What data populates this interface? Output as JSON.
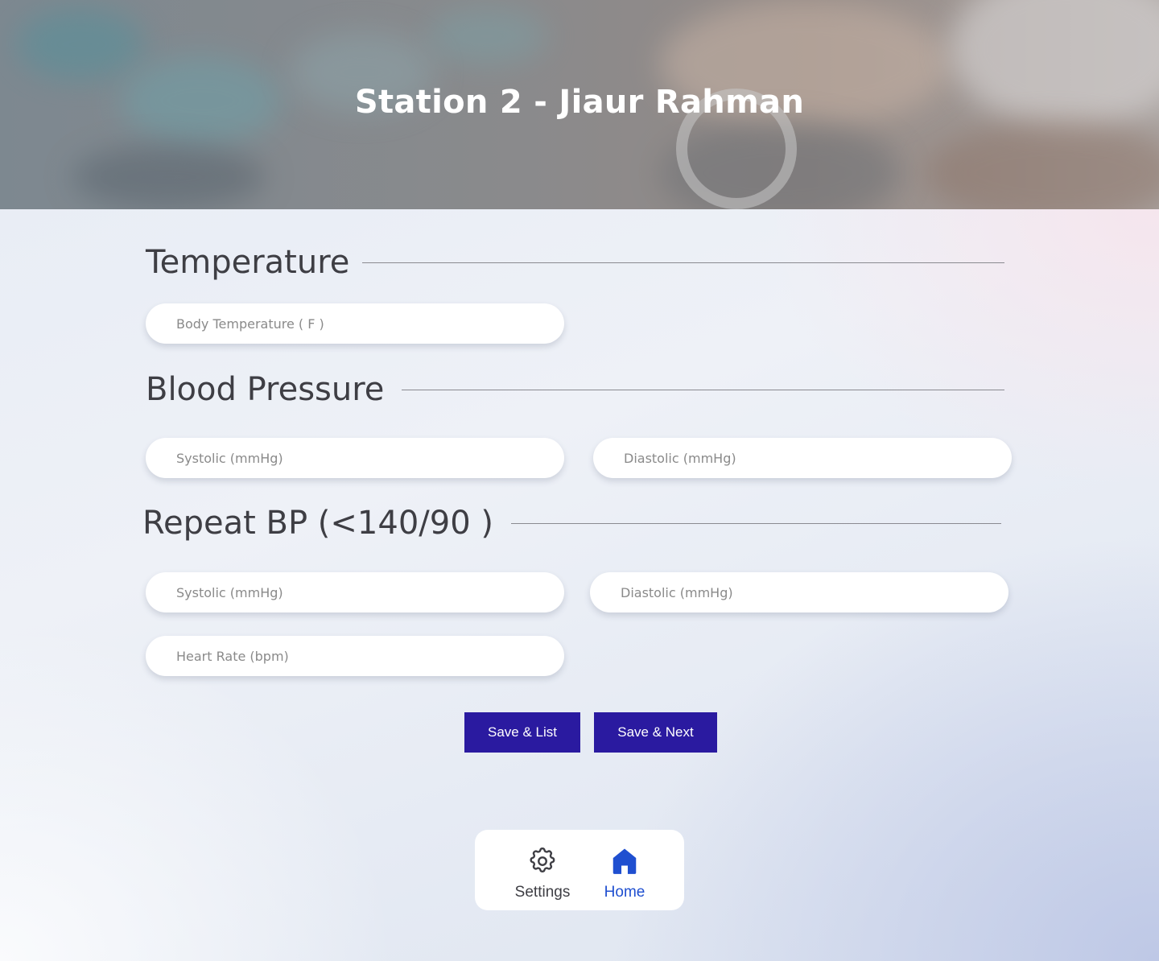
{
  "header": {
    "title": "Station 2 - Jiaur Rahman"
  },
  "sections": {
    "temperature": {
      "title": "Temperature",
      "body_temp_placeholder": "Body Temperature ( F )"
    },
    "blood_pressure": {
      "title": "Blood Pressure",
      "systolic_placeholder": "Systolic (mmHg)",
      "diastolic_placeholder": "Diastolic (mmHg)"
    },
    "repeat_bp": {
      "title": "Repeat BP (<140/90 )",
      "systolic_placeholder": "Systolic (mmHg)",
      "diastolic_placeholder": "Diastolic (mmHg)",
      "heart_rate_placeholder": "Heart Rate (bpm)"
    }
  },
  "actions": {
    "save_list_label": "Save & List",
    "save_next_label": "Save & Next"
  },
  "bottom_nav": {
    "items": [
      {
        "label": "Settings",
        "icon": "gear-icon",
        "active": false
      },
      {
        "label": "Home",
        "icon": "home-icon",
        "active": true
      }
    ]
  },
  "colors": {
    "primary_button": "#2a1aa0",
    "nav_active": "#1f4fd0",
    "heading_text": "#3e3e44"
  }
}
